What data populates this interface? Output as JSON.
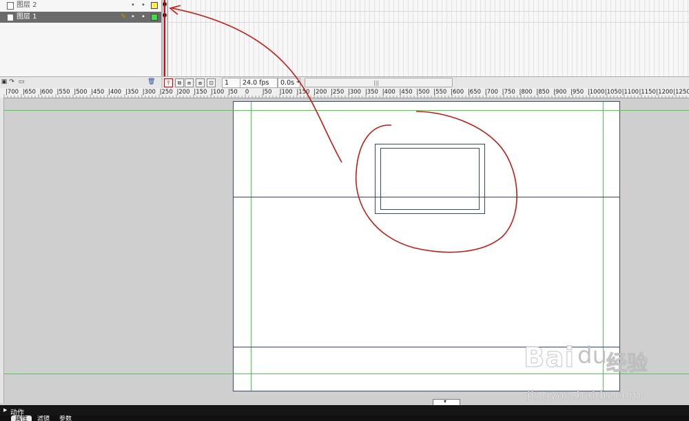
{
  "timeline": {
    "layers": [
      {
        "name": "图层 2",
        "visible_dot": "•",
        "lock_dot": "•",
        "outline_color": "#ffee55",
        "selected": false
      },
      {
        "name": "图层 1",
        "visible_dot": "•",
        "lock_dot": "•",
        "outline_color": "#44dd44",
        "selected": true
      }
    ],
    "edit_icon": "pencil-icon",
    "current_frame": "1",
    "frame_rate": "24.0 fps",
    "elapsed_time": "0.0s",
    "toolbar_icons": [
      "insert-layer-icon",
      "motion-guide-icon",
      "insert-folder-icon",
      "trash-icon"
    ],
    "frame_buttons": [
      "center-frame-icon",
      "onion-skin-icon",
      "onion-skin-outline-icon",
      "edit-multiple-frames-icon",
      "modify-onion-markers-icon"
    ],
    "scroll_grip": "|||",
    "scroll_left_arrow": "◂"
  },
  "ruler": {
    "labels": [
      "|700",
      "|650",
      "|600",
      "|550",
      "|500",
      "|450",
      "|400",
      "|350",
      "|300",
      "|250",
      "|200",
      "|150",
      "|100",
      "|50",
      "0",
      "|50",
      "|100",
      "|150",
      "|200",
      "|250",
      "|300",
      "|350",
      "|400",
      "|450",
      "|500",
      "|550",
      "|600",
      "|650",
      "|700",
      "|750",
      "|800",
      "|850",
      "|900",
      "|950",
      "|1000",
      "|1050",
      "|1100",
      "|1150",
      "|1200",
      "|1250"
    ]
  },
  "stage": {
    "guide_color": "#46d046",
    "line_color": "#2f456a",
    "scroll_handle_glyph": "▾"
  },
  "annotation": {
    "color": "#c41a14"
  },
  "panels": {
    "actions_arrow": "▶",
    "actions_label": "动作",
    "bottom_tabs": [
      "属性",
      "滤镜",
      "参数"
    ]
  },
  "watermark": {
    "logo": "Bai",
    "logo_paw": "du",
    "chinese": "经验",
    "url": "jingyan.baidu.com"
  }
}
